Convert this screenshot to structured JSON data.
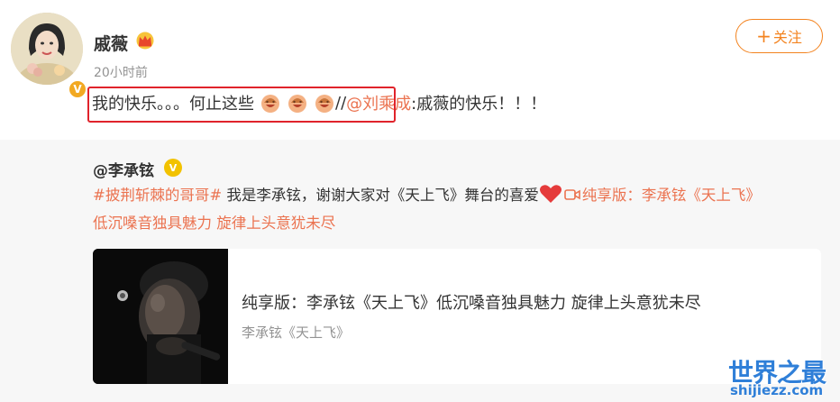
{
  "post": {
    "username": "戚薇",
    "time": "20小时前",
    "follow_label": "关注",
    "follow_plus": "+",
    "verified_mark": "V",
    "text_before": "我的快乐。。。何止这些",
    "separator": "//",
    "mention": "@刘乘成",
    "text_after": ":戚薇的快乐！！！",
    "icons": [
      "avatar",
      "crown-icon",
      "verified-icon",
      "laugh-emoji-icon"
    ]
  },
  "repost": {
    "username": "@李承铉",
    "verified_mark": "V",
    "hashtag": "#披荆斩棘的哥哥#",
    "text_mid": " 我是李承铉，谢谢大家对《天上飞》舞台的喜爱",
    "video_link_line1": "纯享版：李承铉《天上飞》",
    "video_link_line2": "低沉嗓音独具魅力 旋律上头意犹未尽",
    "icons": [
      "heart-icon",
      "video-icon"
    ],
    "card": {
      "title": "纯享版：李承铉《天上飞》低沉嗓音独具魅力 旋律上头意犹未尽",
      "subtitle": "李承铉《天上飞》"
    }
  },
  "watermark": {
    "main": "世界之最",
    "sub": "shijiezz.com"
  },
  "colors": {
    "accent": "#eb7350",
    "follow": "#f3831f",
    "highlight_box": "#e0232b",
    "watermark": "#2f7fd8"
  }
}
